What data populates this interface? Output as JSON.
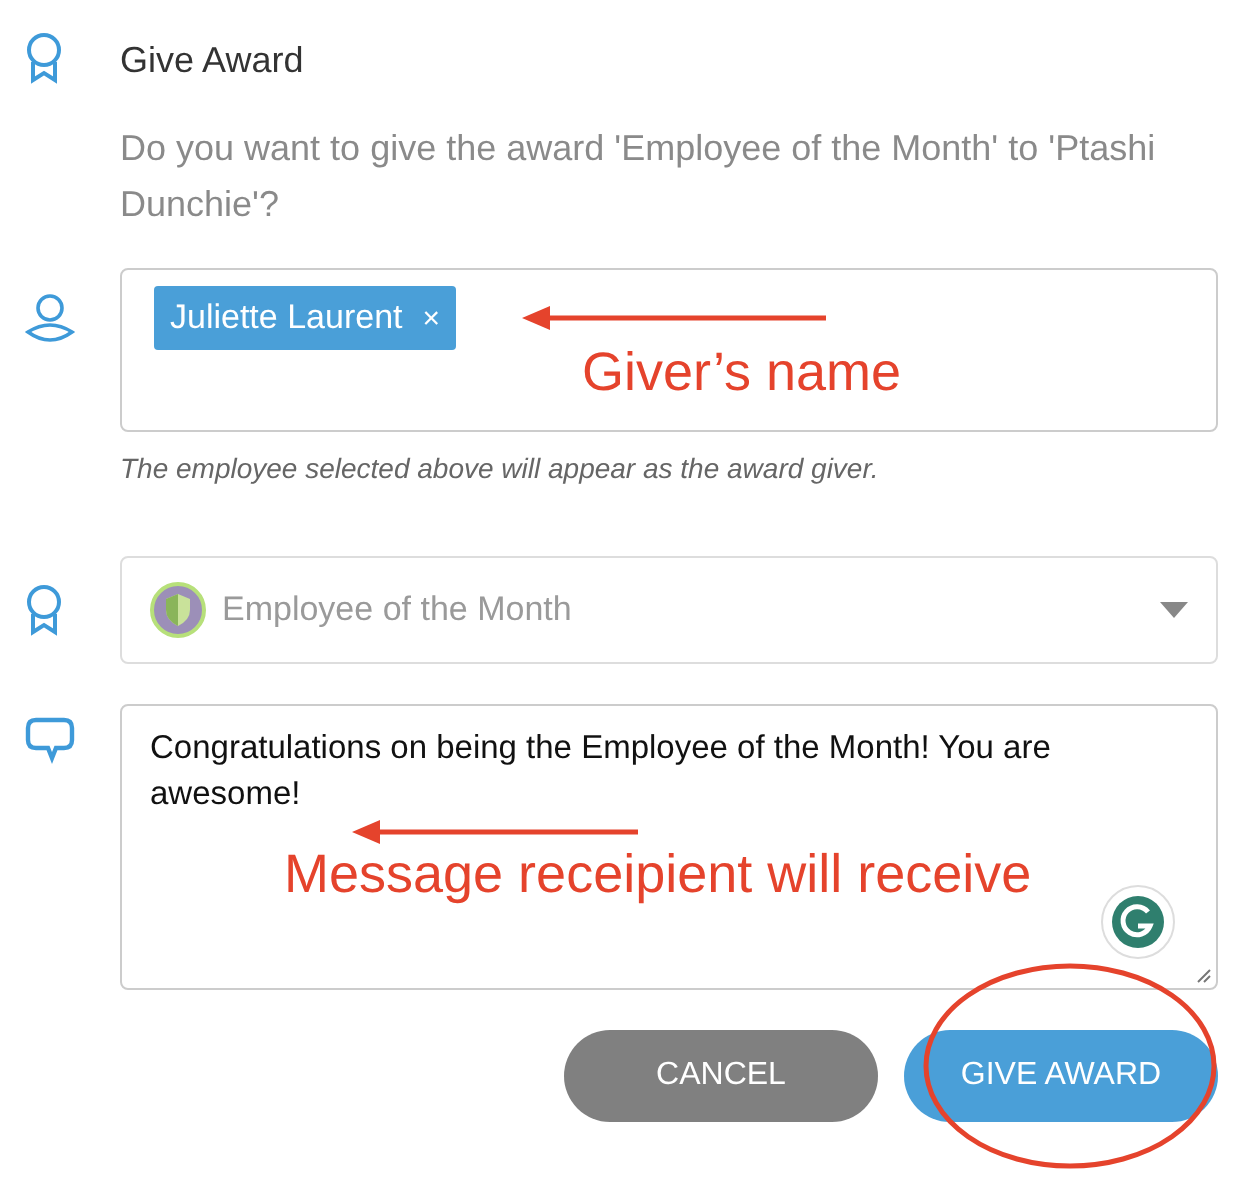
{
  "dialog": {
    "title": "Give Award",
    "question": "Do you want to give the award 'Employee of the Month' to 'Ptashi Dunchie'?",
    "giver": {
      "tags": [
        {
          "label": "Juliette Laurent",
          "remove": "×"
        }
      ],
      "hint": "The employee selected above will appear as the award giver.",
      "annotation": "Giver’s name"
    },
    "award_select": {
      "value": "Employee of the Month",
      "disabled": true
    },
    "message": {
      "value": "Congratulations on being the Employee of the Month! You are awesome!",
      "annotation": "Message receipient will receive"
    },
    "buttons": [
      {
        "label": "CANCEL",
        "kind": "secondary",
        "circled": false
      },
      {
        "label": "GIVE AWARD",
        "kind": "primary",
        "circled": true
      }
    ]
  }
}
